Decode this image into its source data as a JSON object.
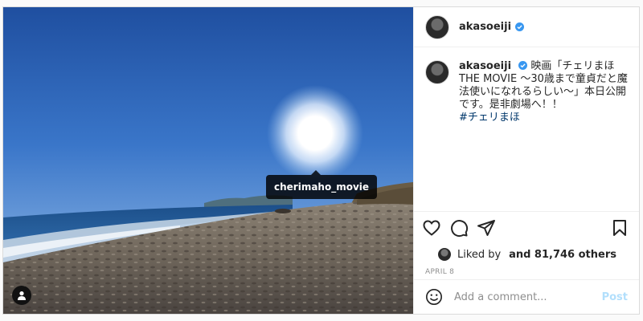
{
  "post": {
    "username": "akasoeiji",
    "verified": true,
    "tagged_user": "cherimaho_movie",
    "caption": {
      "username": "akasoeiji",
      "text": "映画「チェリまほ　THE MOVIE ～30歳まで童貞だと魔法使いになれるらしい～」本日公開です。是非劇場へ！！",
      "hashtag": "#チェリまほ"
    },
    "likes": {
      "prefix": "Liked by",
      "suffix": "and 81,746 others"
    },
    "date": "APRIL 8",
    "comment": {
      "placeholder": "Add a comment...",
      "post_label": "Post"
    }
  },
  "icons": {
    "like": "heart-icon",
    "comment": "comment-icon",
    "share": "paper-plane-icon",
    "save": "bookmark-icon",
    "emoji": "emoji-icon",
    "user_tag": "user-icon",
    "verified": "verified-badge-icon"
  },
  "colors": {
    "verified": "#3897f0",
    "hashtag": "#00376b",
    "post_disabled": "#b2dffc"
  }
}
